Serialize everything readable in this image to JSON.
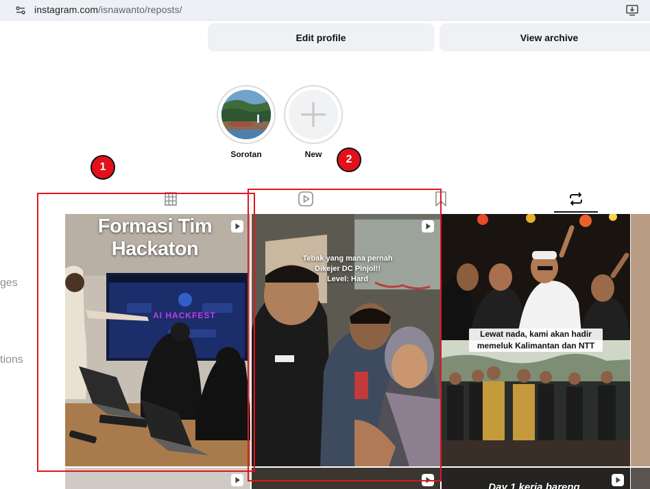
{
  "browser": {
    "url_host": "instagram.com",
    "url_path": "/isnawanto/reposts/"
  },
  "profile": {
    "edit_label": "Edit profile",
    "archive_label": "View archive"
  },
  "highlights": [
    {
      "label": "Sorotan"
    },
    {
      "label": "New"
    }
  ],
  "sidebar": {
    "partial_1": "ges",
    "partial_2": "tions"
  },
  "tabs": [
    {
      "name": "posts",
      "icon": "grid-icon"
    },
    {
      "name": "reels",
      "icon": "reels-icon"
    },
    {
      "name": "saved",
      "icon": "bookmark-icon"
    },
    {
      "name": "reposts",
      "icon": "repost-icon",
      "active": true
    }
  ],
  "posts": [
    {
      "caption": "Formasi Tim\nHackaton",
      "type": "reel"
    },
    {
      "caption": "Tebak yang mana pernah\nDikejer DC Pinjol!!\nLevel: Hard",
      "type": "reel"
    },
    {
      "caption": "Lewat nada, kami akan hadir\nmemeluk Kalimantan dan NTT",
      "type": "photo"
    },
    {
      "caption": "",
      "type": "reel"
    },
    {
      "caption": "",
      "type": "reel"
    },
    {
      "caption": "Day 1 kerja bareng",
      "type": "reel"
    }
  ],
  "screen_text": {
    "hackfest_banner": "AI HACKFEST"
  },
  "annotations": [
    {
      "number": "1"
    },
    {
      "number": "2"
    }
  ],
  "colors": {
    "annotation_red": "#e0141e",
    "button_bg": "#eff1f4"
  }
}
